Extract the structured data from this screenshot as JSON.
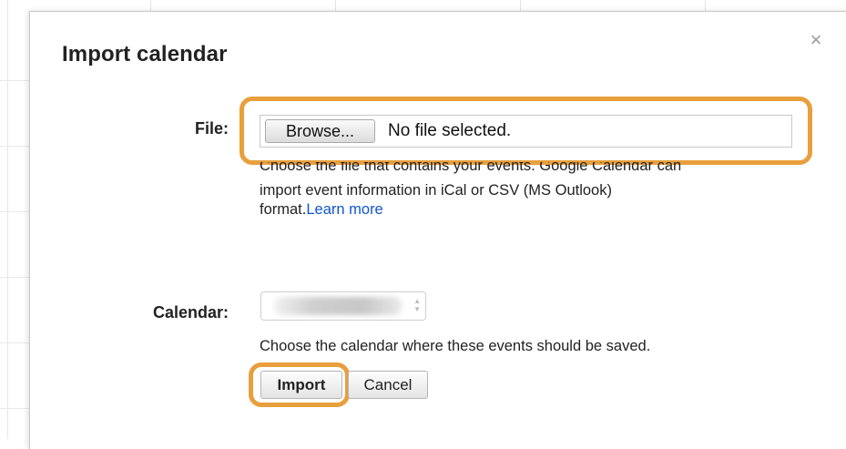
{
  "dialog": {
    "title": "Import calendar",
    "close_symbol": "×"
  },
  "file": {
    "label": "File:",
    "browse_label": "Browse...",
    "status": "No file selected.",
    "help_line1": "Choose the file that contains your events. Google Calendar can",
    "help_line2": "import event information in iCal or CSV (MS Outlook)",
    "help_line3_prefix": "format.",
    "help_link": "Learn more"
  },
  "calendar": {
    "label": "Calendar:",
    "help": "Choose the calendar where these events should be saved."
  },
  "actions": {
    "import_label": "Import",
    "cancel_label": "Cancel"
  },
  "colors": {
    "highlight": "#e89f3c",
    "link": "#1155cc"
  }
}
